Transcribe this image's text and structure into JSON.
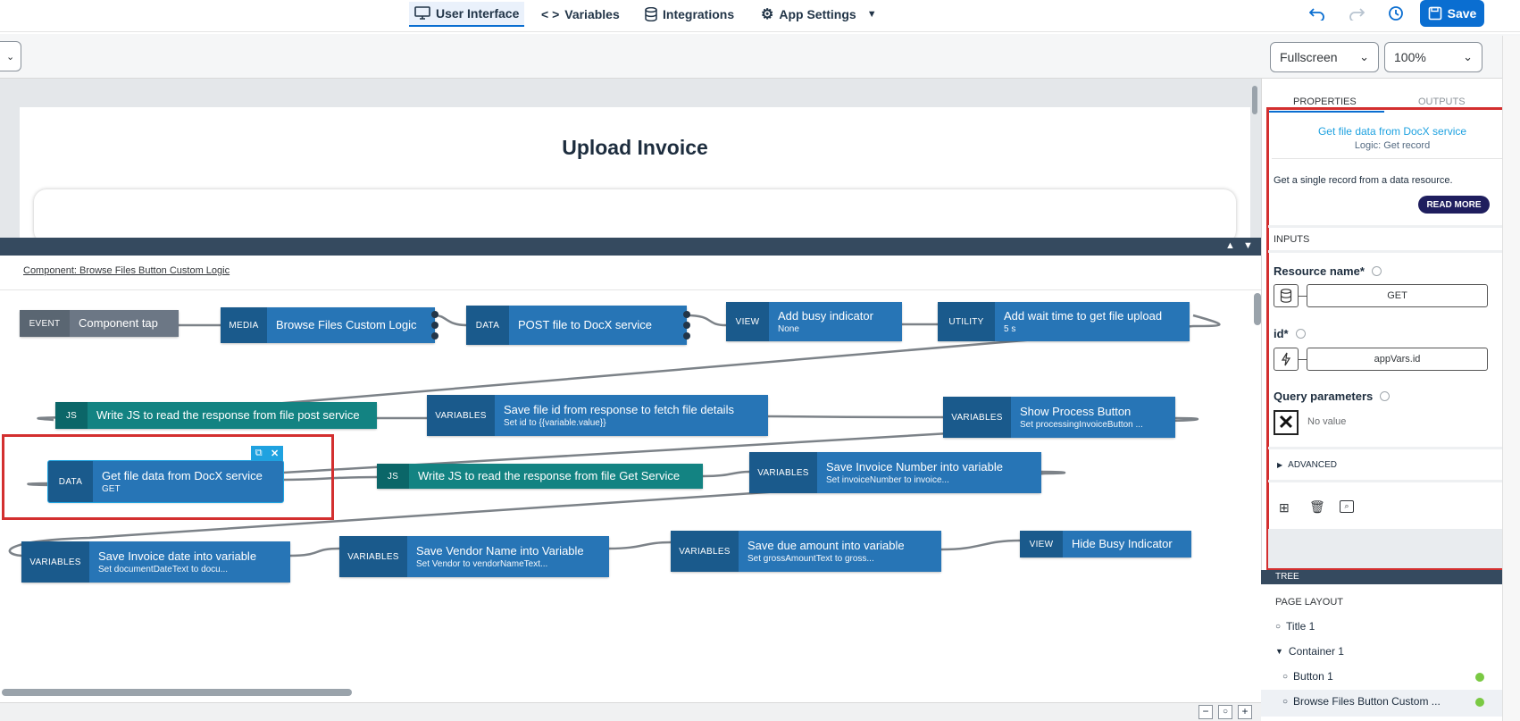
{
  "header": {
    "tabs": [
      {
        "label": "User Interface",
        "icon": "monitor-icon",
        "active": true
      },
      {
        "label": "Variables",
        "icon": "code-icon"
      },
      {
        "label": "Integrations",
        "icon": "database-icon"
      },
      {
        "label": "App Settings",
        "icon": "gear-icon"
      }
    ],
    "save_label": "Save"
  },
  "toolbar": {
    "view_mode": "Fullscreen",
    "zoom": "100%"
  },
  "page": {
    "title": "Upload Invoice"
  },
  "logic": {
    "component_title": "Component: Browse Files Button Custom Logic",
    "nodes": [
      {
        "tag": "EVENT",
        "title": "Component tap",
        "subtitle": ""
      },
      {
        "tag": "MEDIA",
        "title": "Browse Files Custom Logic",
        "subtitle": ""
      },
      {
        "tag": "DATA",
        "title": "POST file to DocX service",
        "subtitle": ""
      },
      {
        "tag": "VIEW",
        "title": "Add busy indicator",
        "subtitle": "None"
      },
      {
        "tag": "UTILITY",
        "title": "Add wait time to get file upload",
        "subtitle": "5 s"
      },
      {
        "tag": "JS",
        "title": "Write JS to read the response from file post service",
        "subtitle": ""
      },
      {
        "tag": "VARIABLES",
        "title": "Save file id from response to fetch file details",
        "subtitle": "Set id to {{variable.value}}"
      },
      {
        "tag": "VARIABLES",
        "title": "Show Process Button",
        "subtitle": "Set processingInvoiceButton ..."
      },
      {
        "tag": "DATA",
        "title": "Get file data from DocX service",
        "subtitle": "GET"
      },
      {
        "tag": "JS",
        "title": "Write JS to read the response from file Get Service",
        "subtitle": ""
      },
      {
        "tag": "VARIABLES",
        "title": "Save Invoice Number into variable",
        "subtitle": "Set invoiceNumber to invoice..."
      },
      {
        "tag": "VARIABLES",
        "title": "Save Invoice date into variable",
        "subtitle": "Set documentDateText to docu..."
      },
      {
        "tag": "VARIABLES",
        "title": "Save Vendor Name into Variable",
        "subtitle": "Set Vendor to vendorNameText..."
      },
      {
        "tag": "VARIABLES",
        "title": "Save due amount into variable",
        "subtitle": "Set grossAmountText to gross..."
      },
      {
        "tag": "VIEW",
        "title": "Hide Busy Indicator",
        "subtitle": ""
      }
    ]
  },
  "properties": {
    "tab_properties": "PROPERTIES",
    "tab_outputs": "OUTPUTS",
    "node_title": "Get file data from DocX service",
    "node_type": "Logic: Get record",
    "description": "Get a single record from a data resource.",
    "read_more": "READ MORE",
    "inputs_label": "INPUTS",
    "resource_label": "Resource name*",
    "resource_value": "GET",
    "id_label": "id*",
    "id_value": "appVars.id",
    "query_label": "Query parameters",
    "query_value": "No value",
    "advanced_label": "ADVANCED"
  },
  "tree": {
    "header": "TREE",
    "section": "PAGE LAYOUT",
    "items": [
      {
        "label": "Title 1"
      },
      {
        "label": "Container 1"
      },
      {
        "label": "Button 1"
      },
      {
        "label": "Browse Files Button Custom ..."
      }
    ]
  },
  "colors": {
    "accent": "#0a6ed1",
    "highlight": "#d32f2f",
    "status_ok": "#7ac943"
  }
}
